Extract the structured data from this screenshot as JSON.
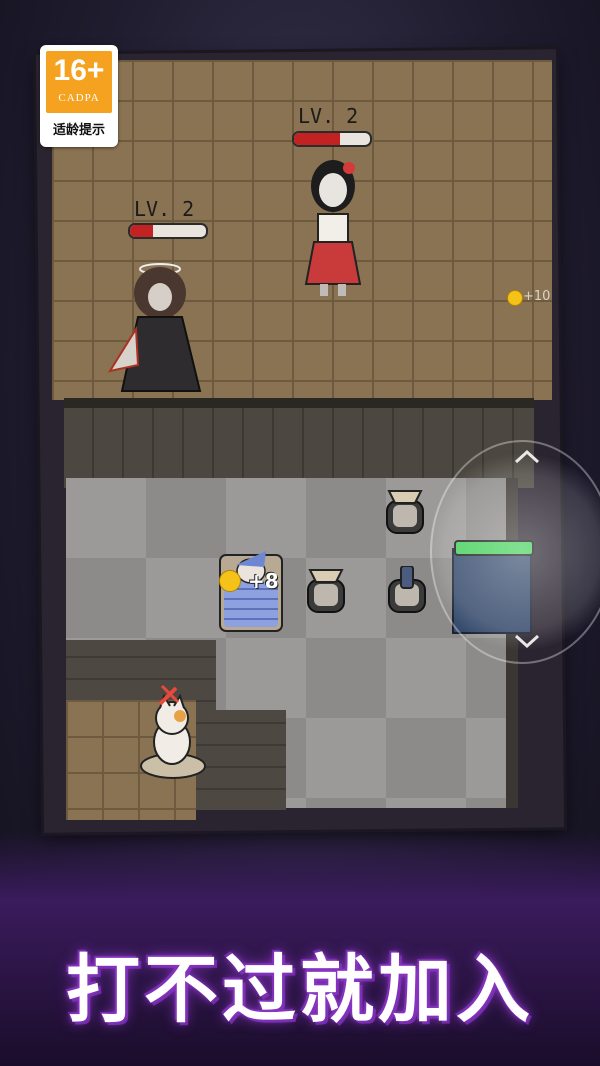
{
  "rating": {
    "age": "16+",
    "org": "CADPA",
    "label": "适龄提示"
  },
  "enemies": [
    {
      "name": "Red dress girl ghost",
      "level_label": "LV. 2",
      "hp": 0.6
    },
    {
      "name": "Winged ghost",
      "level_label": "LV. 2",
      "hp": 0.3
    }
  ],
  "coin_pickup": {
    "text": "+10"
  },
  "player": {
    "gain_text": "+8"
  },
  "tagline": "打不过就加入",
  "colors": {
    "hp": "#c22222",
    "energy": "#43d05a",
    "title_glow": "#8e37c9",
    "coin": "#f5c21a"
  },
  "icons": [
    "coin-icon",
    "sword-icon",
    "chevron-up-icon",
    "chevron-down-icon"
  ]
}
